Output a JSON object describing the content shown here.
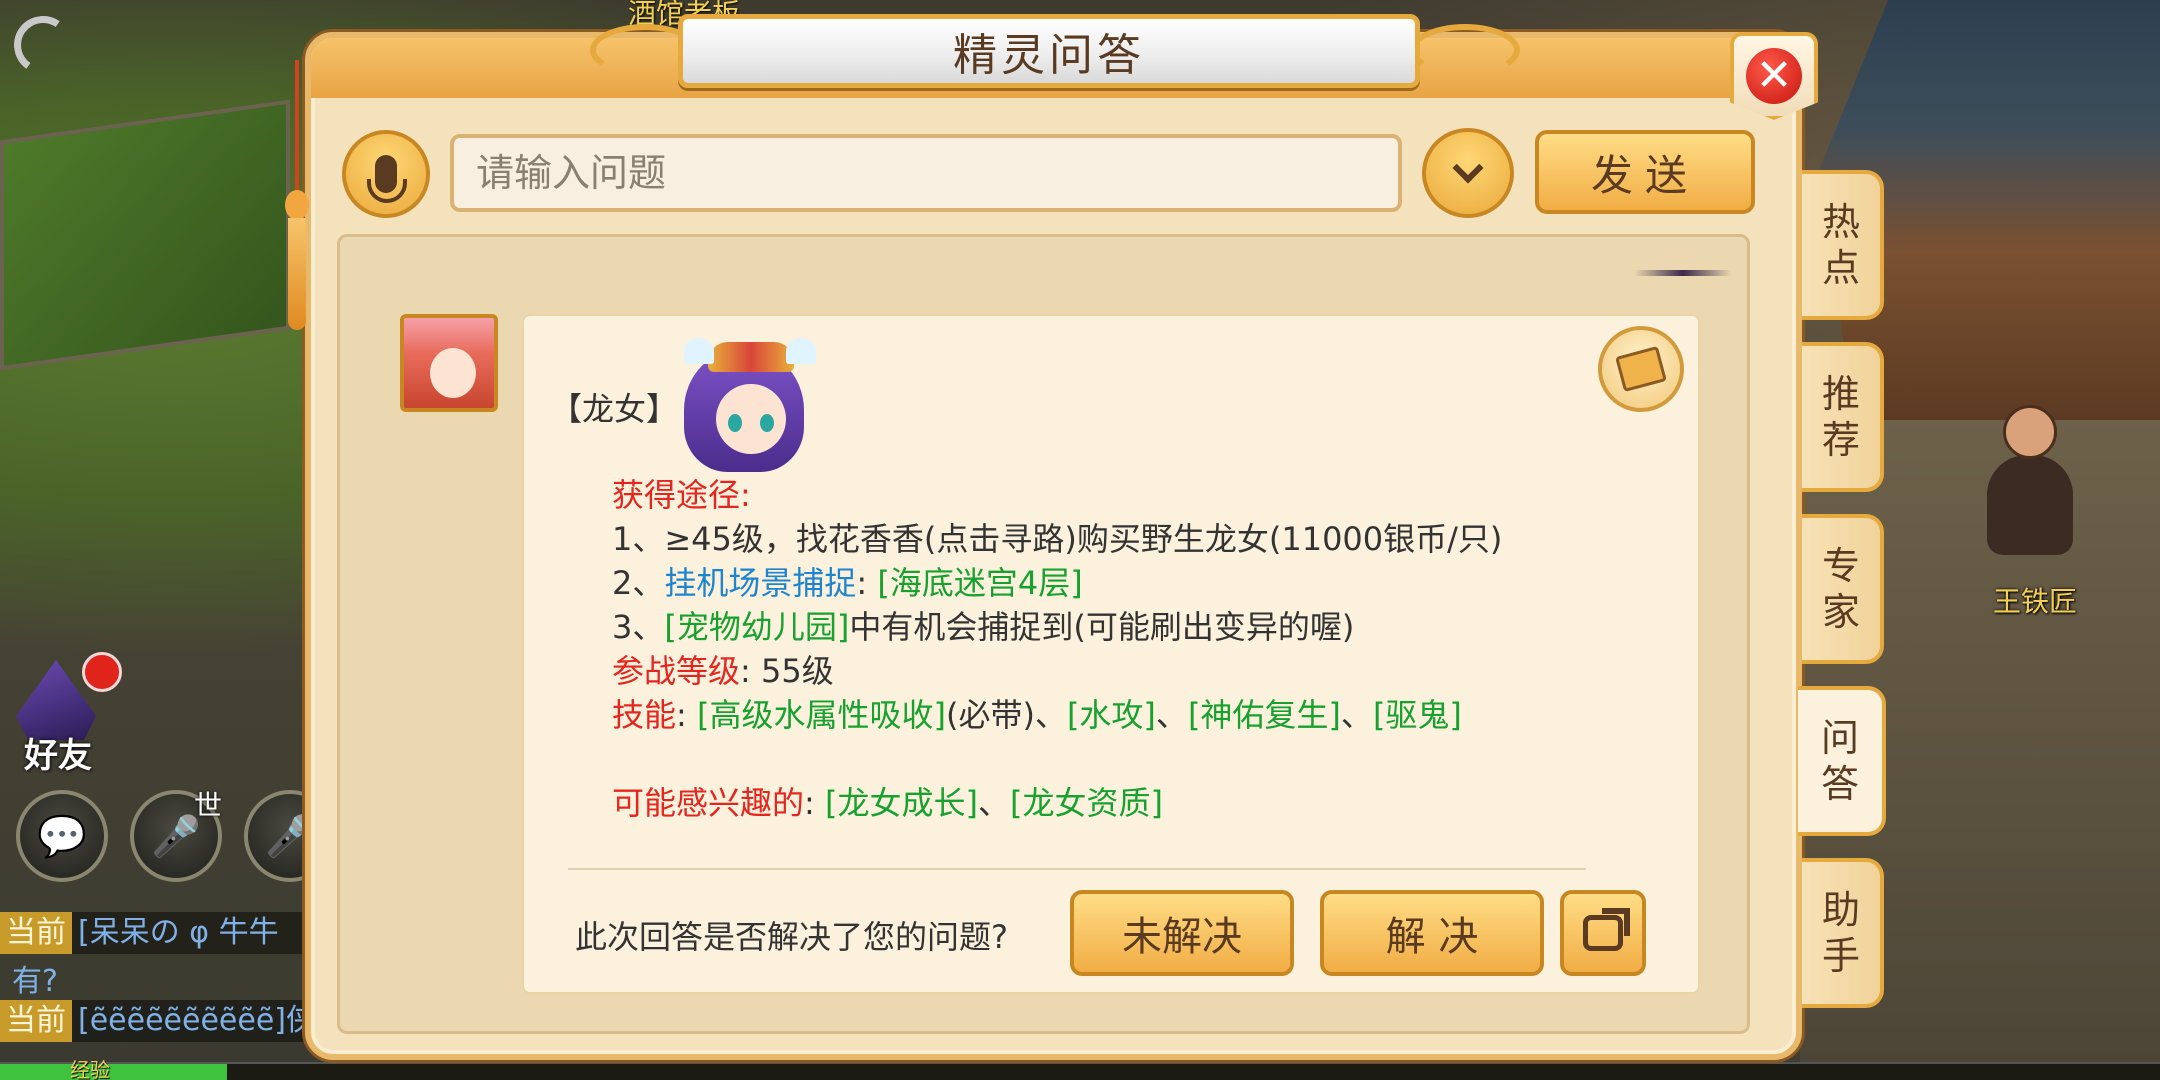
{
  "scene": {
    "top_label": "酒馆老板",
    "npc_name": "王铁匠"
  },
  "hud": {
    "friend_label": "好友",
    "world_voice_tag": "世",
    "chat": [
      {
        "channel": "当前",
        "text": "[呆呆の φ 牛牛"
      },
      {
        "channel": "",
        "text": "有?"
      },
      {
        "channel": "当前",
        "text": "[ẽẽẽẽẽẽẽẽẽẽ]侠义"
      }
    ],
    "exp_label": "经验",
    "exp_fill": 0.105
  },
  "dialog": {
    "title": "精灵问答",
    "close_label": "✕",
    "input_placeholder": "请输入问题",
    "send_label": "发送",
    "answer": {
      "pet_name": "【龙女】",
      "obtain_label": "获得途径:",
      "line1": "1、≥45级，找花香香(点击寻路)购买野生龙女(11000银币/只)",
      "line2_prefix": "2、",
      "line2_link": "挂机场景捕捉",
      "line2_sep": ": ",
      "line2_place": "[海底迷宫4层]",
      "line3_prefix": "3、",
      "line3_place": "[宠物幼儿园]",
      "line3_rest": "中有机会捕捉到(可能刷出变异的喔)",
      "level_label": "参战等级",
      "level_value": ": 55级",
      "skills_label": "技能",
      "skills_colon": ": ",
      "skill1": "[高级水属性吸收]",
      "skill1_note": "(必带)、",
      "skill2": "[水攻]",
      "sep": "、",
      "skill3": "[神佑复生]",
      "skill4": "[驱鬼]",
      "interest_label": "可能感兴趣的",
      "interest_colon": ": ",
      "interest1": "[龙女成长]",
      "interest2": "[龙女资质]"
    },
    "feedback_question": "此次回答是否解决了您的问题?",
    "unsolved_label": "未解决",
    "solved_label": "解 决"
  },
  "side_tabs": [
    {
      "label": "热\n点",
      "active": false
    },
    {
      "label": "推\n荐",
      "active": false
    },
    {
      "label": "专\n家",
      "active": false
    },
    {
      "label": "问\n答",
      "active": true
    },
    {
      "label": "助\n手",
      "active": false
    }
  ],
  "icons": [
    "signal-icon",
    "mic-icon",
    "chevron-down-icon",
    "close-icon",
    "book-icon",
    "share-icon",
    "chat-icon",
    "voice-icon"
  ]
}
